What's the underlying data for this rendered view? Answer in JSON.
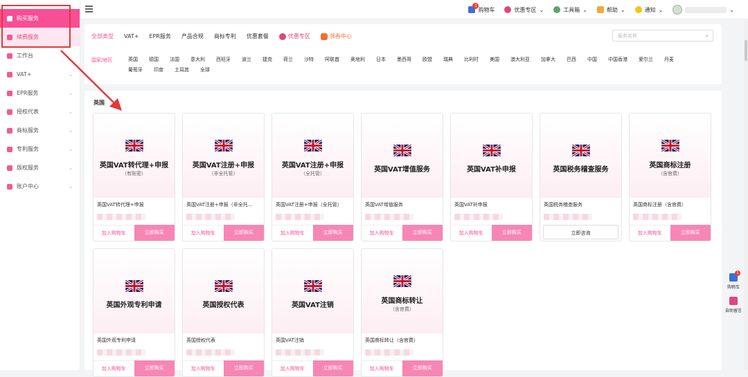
{
  "sidebar": {
    "items": [
      {
        "label": "购买服务"
      },
      {
        "label": "续费服务"
      },
      {
        "label": "工作台"
      },
      {
        "label": "VAT+"
      },
      {
        "label": "EPR服务"
      },
      {
        "label": "授权代表"
      },
      {
        "label": "商标服务"
      },
      {
        "label": "专利服务"
      },
      {
        "label": "版权服务"
      },
      {
        "label": "账户中心"
      }
    ]
  },
  "topbar": {
    "cart": "购物车",
    "cart_badge": "1",
    "promo": "优惠专区",
    "toolbox": "工具箱",
    "help": "帮助",
    "notice": "通知"
  },
  "filter": {
    "tabs": [
      "全部类型",
      "VAT+",
      "EPR服务",
      "产品合规",
      "商标专利",
      "优惠套餐",
      "优惠专区",
      "领券中心"
    ],
    "search_placeholder": "服务名称",
    "region_label": "国家/地区",
    "regions": [
      "英国",
      "德国",
      "法国",
      "意大利",
      "西班牙",
      "波兰",
      "捷克",
      "荷兰",
      "沙特",
      "阿联酋",
      "奥地利",
      "日本",
      "墨西哥",
      "欧盟",
      "瑞典",
      "比利时",
      "美国",
      "澳大利亚",
      "加拿大",
      "巴西",
      "中国",
      "中国香港",
      "爱尔兰",
      "丹麦",
      "葡萄牙",
      "印度",
      "土耳其",
      "全球"
    ]
  },
  "section": {
    "title": "英国"
  },
  "cards": [
    {
      "title": "英国VAT转代理+申报",
      "sub": "（有账密）",
      "name": "英国VAT转代理+申报",
      "btn1": "加入购物车",
      "btn2": "立即购买"
    },
    {
      "title": "英国VAT注册+申报",
      "sub": "（非全托管）",
      "name": "英国VAT注册+申报（非全托...",
      "btn1": "加入购物车",
      "btn2": "立即购买"
    },
    {
      "title": "英国VAT注册+申报",
      "sub": "（全托管）",
      "name": "英国VAT注册+申报（全托管）",
      "btn1": "加入购物车",
      "btn2": "立即购买"
    },
    {
      "title": "英国VAT增值服务",
      "sub": "",
      "name": "英国VAT增值服务",
      "btn1": "加入购物车",
      "btn2": "立即购买"
    },
    {
      "title": "英国VAT补申报",
      "sub": "",
      "name": "英国VAT补申报",
      "btn1": "加入购物车",
      "btn2": "立即购买"
    },
    {
      "title": "英国税务稽查服务",
      "sub": "",
      "name": "英国税务稽查服务",
      "btn1": "立即咨询",
      "btn2": ""
    },
    {
      "title": "英国商标注册",
      "sub": "（含官费）",
      "name": "英国商标注册（含官费）",
      "btn1": "加入购物车",
      "btn2": "立即购买"
    },
    {
      "title": "英国外观专利申请",
      "sub": "",
      "name": "英国外观专利申请",
      "btn1": "加入购物车",
      "btn2": "立即购买"
    },
    {
      "title": "英国授权代表",
      "sub": "",
      "name": "英国授权代表",
      "btn1": "加入购物车",
      "btn2": "立即购买"
    },
    {
      "title": "英国VAT注销",
      "sub": "",
      "name": "英国VAT注销",
      "btn1": "加入购物车",
      "btn2": "立即购买"
    },
    {
      "title": "英国商标转让",
      "sub": "（含官费）",
      "name": "英国商标转让（含官费）",
      "btn1": "加入购物车",
      "btn2": "立即购买"
    }
  ],
  "float": {
    "cart": "购物车",
    "cart_badge": "1",
    "message": "自助留言"
  },
  "colors": {
    "accent": "#f74e96",
    "highlight": "#e53935"
  }
}
